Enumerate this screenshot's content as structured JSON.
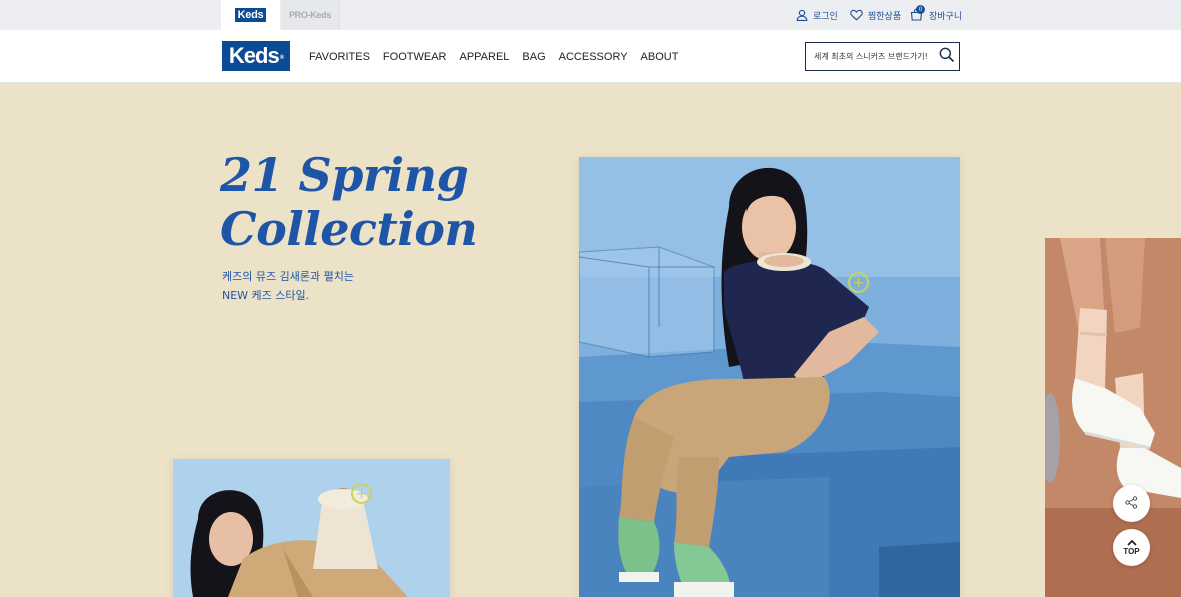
{
  "topbar": {
    "brand_tabs": [
      {
        "label": "Keds",
        "active": true
      },
      {
        "label": "PRO-Keds",
        "active": false
      }
    ],
    "utilities": {
      "login": "로그인",
      "wishlist": "찜한상품",
      "cart": "장바구니",
      "cart_count": "0"
    }
  },
  "header": {
    "logo": "Keds",
    "nav": [
      "FAVORITES",
      "FOOTWEAR",
      "APPAREL",
      "BAG",
      "ACCESSORY",
      "ABOUT"
    ],
    "search": {
      "placeholder": "세계 최초의 스니커즈 브랜드가기!",
      "icon": "search-icon"
    }
  },
  "hero": {
    "title_line1": "21 Spring",
    "title_line2": "Collection",
    "subtitle_line1": "케즈의 뮤즈 김새론과 펼치는",
    "subtitle_line2": "NEW 케즈 스타일."
  },
  "images": {
    "main": "model-sitting-on-blue-steps",
    "left": "model-with-beige-bag",
    "right": "white-sneakers-with-socks",
    "mini_logo": "Keds"
  },
  "floating": {
    "share_icon": "share-icon",
    "top_label": "TOP"
  },
  "colors": {
    "brand_blue": "#0b4a94",
    "accent_blue": "#1f55a7",
    "background": "#ebe2c7",
    "hotspot": "#c8d35f"
  }
}
